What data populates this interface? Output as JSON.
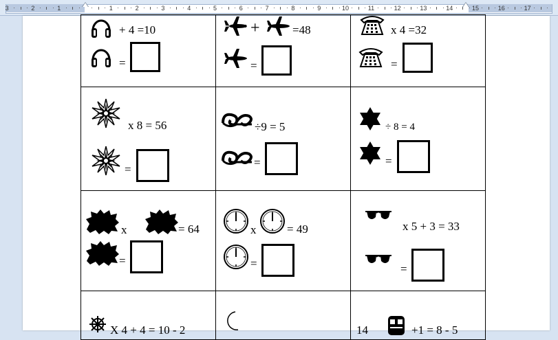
{
  "ruler": {
    "left_numbers": [
      "3",
      "2",
      "1"
    ],
    "right_numbers": [
      "1",
      "2",
      "3",
      "4",
      "5",
      "6",
      "7",
      "8",
      "9",
      "10",
      "11",
      "12",
      "13",
      "14",
      "15",
      "16",
      "17"
    ]
  },
  "puzzles": {
    "headphones_line": "+ 4 =10",
    "plane_line": "=48",
    "telephone_line": "x 4 =32",
    "starburst_line": "x 8 = 56",
    "scroll_line": "÷9 = 5",
    "star_line": "÷ 8 = 4",
    "cloud_times": "x",
    "cloud_line": "= 64",
    "clock_times": "x",
    "clock_line": "= 49",
    "sunglasses_line": "x 5 + 3 = 33",
    "wheel_line": "X 4 + 4 = 10 - 2",
    "train_line_a": "14",
    "train_line_b": "+1 = 8 - 5",
    "equals": "="
  },
  "colors": {
    "ink": "#000000",
    "page": "#ffffff",
    "background": "#d7e3f2"
  }
}
